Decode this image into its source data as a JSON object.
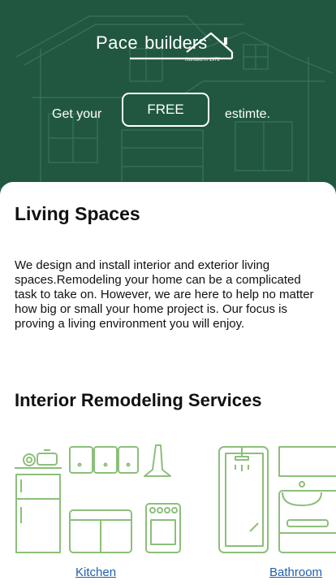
{
  "header": {
    "logo": {
      "brand_first": "Pace",
      "brand_second": "builders",
      "founded": "founded in 1972"
    },
    "cta": {
      "prefix": "Get your",
      "button_label": "FREE",
      "suffix": "estimte."
    }
  },
  "main": {
    "title": "Living Spaces",
    "description": "We design and install interior and exterior living spaces.Remodeling your home can be a complicated task to take on. However, we are here to help no matter how big or small your home project is. Our focus is proving a living environment you will enjoy.",
    "services_title": "Interior Remodeling Services",
    "services": [
      {
        "label": "Kitchen",
        "icon": "kitchen-icon"
      },
      {
        "label": "Bathroom",
        "icon": "bathroom-icon"
      }
    ]
  },
  "colors": {
    "brand_green": "#215740",
    "icon_green": "#8cbf7a",
    "link_blue": "#1f5fb0"
  }
}
